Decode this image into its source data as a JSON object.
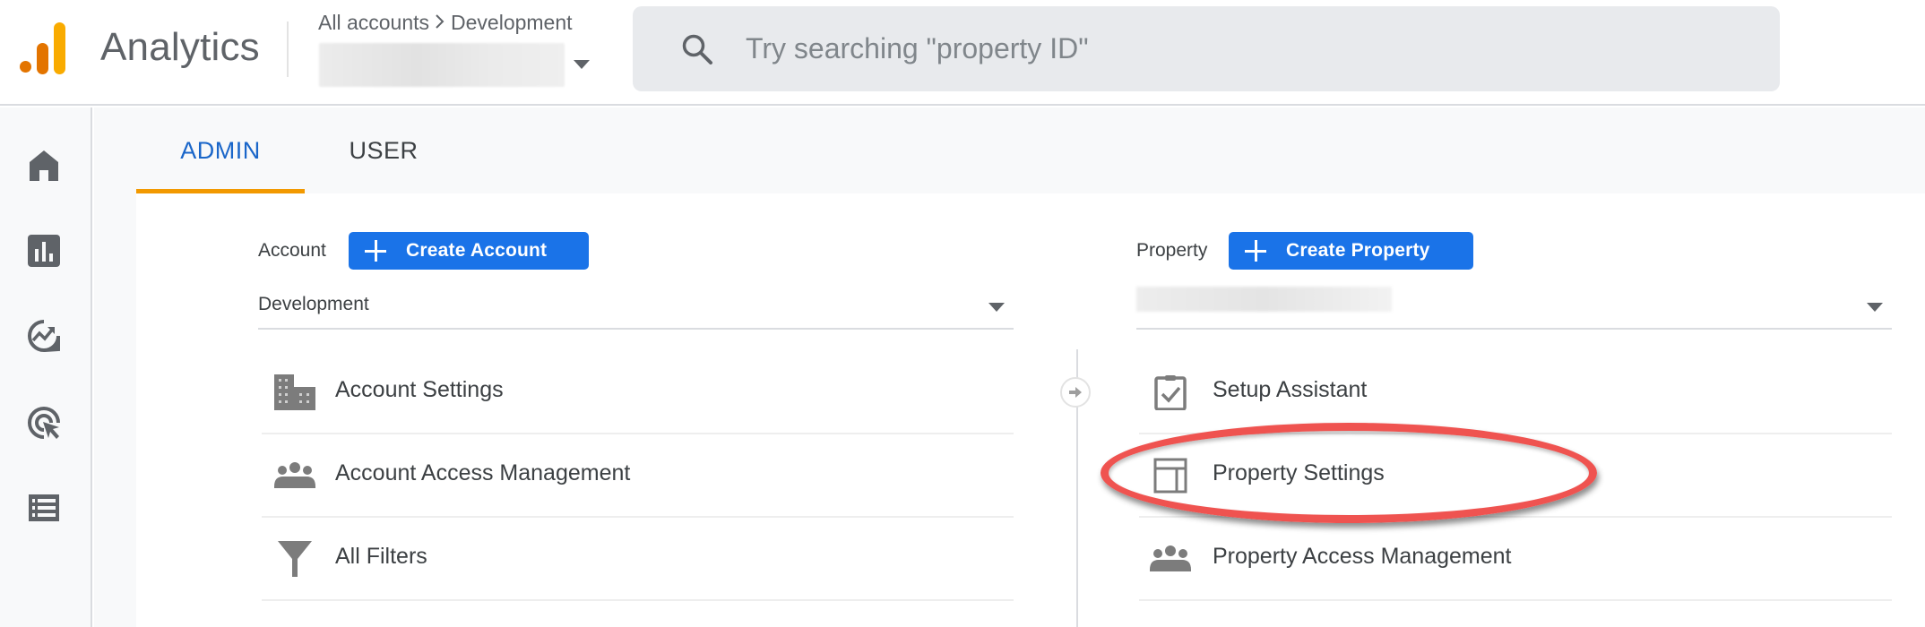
{
  "header": {
    "app_title": "Analytics",
    "breadcrumb": [
      "All accounts",
      "Development"
    ],
    "breadcrumb_separator": ">",
    "account_selector": {
      "value_redacted": true
    },
    "search": {
      "placeholder": "Try searching \"property ID\"",
      "value": ""
    }
  },
  "brand_colors": {
    "logo_dark": "#E37400",
    "logo_light": "#F9AB00",
    "accent_blue": "#1a73e8",
    "tab_underline": "#f29900",
    "annotation": "#ef5350"
  },
  "sidebar": {
    "items": [
      {
        "name": "home",
        "icon": "home-icon"
      },
      {
        "name": "reports",
        "icon": "bar-chart-icon"
      },
      {
        "name": "explore",
        "icon": "explore-trend-icon"
      },
      {
        "name": "advertising",
        "icon": "target-cursor-icon"
      },
      {
        "name": "configure",
        "icon": "list-icon"
      }
    ]
  },
  "tabs": [
    {
      "label": "ADMIN",
      "active": true
    },
    {
      "label": "USER",
      "active": false
    }
  ],
  "account_column": {
    "label": "Account",
    "create_button": "Create Account",
    "selected": "Development",
    "items": [
      {
        "label": "Account Settings",
        "icon": "building-icon"
      },
      {
        "label": "Account Access Management",
        "icon": "people-icon"
      },
      {
        "label": "All Filters",
        "icon": "filter-icon"
      }
    ]
  },
  "property_column": {
    "label": "Property",
    "create_button": "Create Property",
    "selected_redacted": true,
    "items": [
      {
        "label": "Setup Assistant",
        "icon": "clipboard-check-icon"
      },
      {
        "label": "Property Settings",
        "icon": "layout-icon",
        "highlighted": true
      },
      {
        "label": "Property Access Management",
        "icon": "people-icon"
      }
    ]
  }
}
